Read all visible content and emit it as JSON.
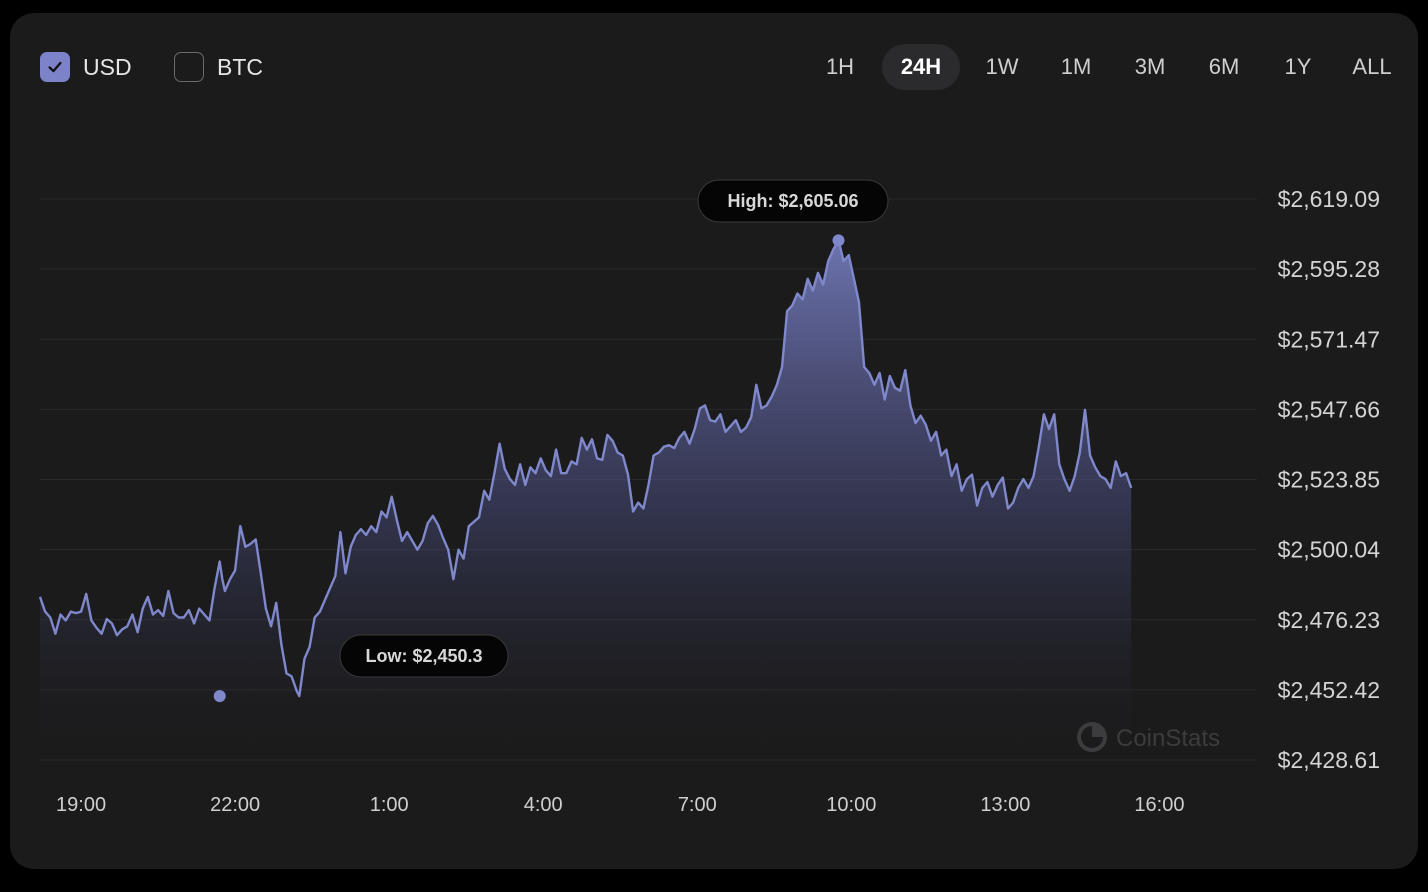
{
  "currencies": [
    {
      "label": "USD",
      "checked": true
    },
    {
      "label": "BTC",
      "checked": false
    }
  ],
  "ranges": [
    {
      "label": "1H",
      "active": false
    },
    {
      "label": "24H",
      "active": true
    },
    {
      "label": "1W",
      "active": false
    },
    {
      "label": "1M",
      "active": false
    },
    {
      "label": "3M",
      "active": false
    },
    {
      "label": "6M",
      "active": false
    },
    {
      "label": "1Y",
      "active": false
    },
    {
      "label": "ALL",
      "active": false
    }
  ],
  "watermark": "CoinStats",
  "colors": {
    "accent": "#7c83c9",
    "line": "#8088cc",
    "background": "#1b1b1c",
    "grid": "#2a2a2c"
  },
  "chart_data": {
    "type": "area",
    "x_unit": "hours since 19:00",
    "xlim": [
      -0.8,
      22.9
    ],
    "ylim": [
      2428.61,
      2619.09
    ],
    "yticks": [
      "$2,619.09",
      "$2,595.28",
      "$2,571.47",
      "$2,547.66",
      "$2,523.85",
      "$2,500.04",
      "$2,476.23",
      "$2,452.42",
      "$2,428.61"
    ],
    "xticks": [
      {
        "x": 0,
        "label": "19:00"
      },
      {
        "x": 3,
        "label": "22:00"
      },
      {
        "x": 6,
        "label": "1:00"
      },
      {
        "x": 9,
        "label": "4:00"
      },
      {
        "x": 12,
        "label": "7:00"
      },
      {
        "x": 15,
        "label": "10:00"
      },
      {
        "x": 18,
        "label": "13:00"
      },
      {
        "x": 21,
        "label": "16:00"
      }
    ],
    "grid": true,
    "high": {
      "label": "High: $2,605.06",
      "x": 14.75,
      "y": 2605.06
    },
    "low": {
      "label": "Low: $2,450.3",
      "x": 2.7,
      "y": 2450.3
    },
    "series": [
      {
        "points": [
          [
            -0.8,
            2484.0
          ],
          [
            -0.7,
            2479.0
          ],
          [
            -0.6,
            2477.0
          ],
          [
            -0.5,
            2471.5
          ],
          [
            -0.4,
            2478.0
          ],
          [
            -0.3,
            2476.0
          ],
          [
            -0.2,
            2479.0
          ],
          [
            -0.1,
            2478.5
          ],
          [
            0.0,
            2479.0
          ],
          [
            0.1,
            2485.0
          ],
          [
            0.2,
            2476.0
          ],
          [
            0.3,
            2473.5
          ],
          [
            0.4,
            2471.5
          ],
          [
            0.5,
            2476.5
          ],
          [
            0.6,
            2475.0
          ],
          [
            0.7,
            2471.0
          ],
          [
            0.8,
            2473.0
          ],
          [
            0.9,
            2474.0
          ],
          [
            1.0,
            2478.0
          ],
          [
            1.1,
            2472.0
          ],
          [
            1.2,
            2480.0
          ],
          [
            1.3,
            2484.0
          ],
          [
            1.4,
            2478.0
          ],
          [
            1.5,
            2479.5
          ],
          [
            1.6,
            2477.5
          ],
          [
            1.7,
            2486.0
          ],
          [
            1.8,
            2478.5
          ],
          [
            1.9,
            2477.0
          ],
          [
            2.0,
            2477.0
          ],
          [
            2.1,
            2479.5
          ],
          [
            2.2,
            2475.0
          ],
          [
            2.3,
            2480.0
          ],
          [
            2.4,
            2478.0
          ],
          [
            2.5,
            2476.0
          ],
          [
            2.6,
            2487.0
          ],
          [
            2.7,
            2496.0
          ],
          [
            2.75,
            2490.0
          ],
          [
            2.8,
            2486.0
          ],
          [
            2.9,
            2490.0
          ],
          [
            3.0,
            2493.0
          ],
          [
            3.1,
            2508.0
          ],
          [
            3.2,
            2501.0
          ],
          [
            3.3,
            2502.0
          ],
          [
            3.4,
            2503.5
          ],
          [
            3.5,
            2492.0
          ],
          [
            3.6,
            2480.0
          ],
          [
            3.7,
            2474.0
          ],
          [
            3.8,
            2482.0
          ],
          [
            3.9,
            2468.0
          ],
          [
            4.0,
            2458.0
          ],
          [
            4.1,
            2457.0
          ],
          [
            4.2,
            2452.0
          ],
          [
            4.25,
            2450.3
          ],
          [
            4.35,
            2463.0
          ],
          [
            4.45,
            2467.0
          ],
          [
            4.55,
            2477.0
          ],
          [
            4.65,
            2479.0
          ],
          [
            4.75,
            2483.0
          ],
          [
            4.85,
            2487.0
          ],
          [
            4.95,
            2491.0
          ],
          [
            5.05,
            2506.0
          ],
          [
            5.15,
            2492.0
          ],
          [
            5.25,
            2501.0
          ],
          [
            5.35,
            2505.0
          ],
          [
            5.45,
            2507.0
          ],
          [
            5.55,
            2505.0
          ],
          [
            5.65,
            2508.0
          ],
          [
            5.75,
            2506.0
          ],
          [
            5.85,
            2513.0
          ],
          [
            5.95,
            2511.0
          ],
          [
            6.05,
            2518.0
          ],
          [
            6.15,
            2510.0
          ],
          [
            6.25,
            2503.0
          ],
          [
            6.35,
            2506.0
          ],
          [
            6.45,
            2503.0
          ],
          [
            6.55,
            2500.0
          ],
          [
            6.65,
            2503.0
          ],
          [
            6.75,
            2509.0
          ],
          [
            6.85,
            2511.5
          ],
          [
            6.95,
            2508.5
          ],
          [
            7.05,
            2504.0
          ],
          [
            7.15,
            2500.0
          ],
          [
            7.25,
            2490.0
          ],
          [
            7.35,
            2500.0
          ],
          [
            7.45,
            2497.0
          ],
          [
            7.55,
            2508.0
          ],
          [
            7.65,
            2509.5
          ],
          [
            7.75,
            2511.0
          ],
          [
            7.85,
            2520.0
          ],
          [
            7.95,
            2517.0
          ],
          [
            8.05,
            2526.0
          ],
          [
            8.15,
            2536.0
          ],
          [
            8.25,
            2527.5
          ],
          [
            8.35,
            2524.0
          ],
          [
            8.45,
            2522.0
          ],
          [
            8.55,
            2529.0
          ],
          [
            8.65,
            2522.0
          ],
          [
            8.75,
            2528.0
          ],
          [
            8.85,
            2526.0
          ],
          [
            8.95,
            2531.0
          ],
          [
            9.05,
            2527.0
          ],
          [
            9.15,
            2525.0
          ],
          [
            9.25,
            2534.0
          ],
          [
            9.35,
            2526.0
          ],
          [
            9.45,
            2526.0
          ],
          [
            9.55,
            2530.0
          ],
          [
            9.65,
            2529.0
          ],
          [
            9.75,
            2538.0
          ],
          [
            9.85,
            2534.0
          ],
          [
            9.95,
            2537.5
          ],
          [
            10.05,
            2531.0
          ],
          [
            10.15,
            2530.5
          ],
          [
            10.25,
            2539.0
          ],
          [
            10.35,
            2537.0
          ],
          [
            10.45,
            2533.0
          ],
          [
            10.55,
            2532.0
          ],
          [
            10.65,
            2525.5
          ],
          [
            10.75,
            2513.0
          ],
          [
            10.85,
            2516.0
          ],
          [
            10.95,
            2514.0
          ],
          [
            11.05,
            2522.0
          ],
          [
            11.15,
            2532.0
          ],
          [
            11.25,
            2533.0
          ],
          [
            11.35,
            2535.0
          ],
          [
            11.45,
            2535.5
          ],
          [
            11.55,
            2534.5
          ],
          [
            11.65,
            2538.0
          ],
          [
            11.75,
            2540.0
          ],
          [
            11.85,
            2536.0
          ],
          [
            11.95,
            2541.0
          ],
          [
            12.05,
            2548.0
          ],
          [
            12.15,
            2549.0
          ],
          [
            12.25,
            2544.0
          ],
          [
            12.35,
            2543.5
          ],
          [
            12.45,
            2546.0
          ],
          [
            12.55,
            2540.0
          ],
          [
            12.65,
            2542.0
          ],
          [
            12.75,
            2544.0
          ],
          [
            12.85,
            2540.0
          ],
          [
            12.95,
            2541.5
          ],
          [
            13.05,
            2545.0
          ],
          [
            13.15,
            2556.0
          ],
          [
            13.25,
            2548.0
          ],
          [
            13.35,
            2549.0
          ],
          [
            13.45,
            2552.0
          ],
          [
            13.55,
            2556.0
          ],
          [
            13.65,
            2562.0
          ],
          [
            13.75,
            2581.0
          ],
          [
            13.85,
            2583.0
          ],
          [
            13.95,
            2587.0
          ],
          [
            14.05,
            2585.0
          ],
          [
            14.15,
            2592.0
          ],
          [
            14.25,
            2588.0
          ],
          [
            14.35,
            2594.0
          ],
          [
            14.45,
            2590.0
          ],
          [
            14.55,
            2598.0
          ],
          [
            14.65,
            2602.0
          ],
          [
            14.75,
            2605.06
          ],
          [
            14.85,
            2598.0
          ],
          [
            14.95,
            2600.0
          ],
          [
            15.05,
            2592.0
          ],
          [
            15.15,
            2584.0
          ],
          [
            15.25,
            2562.0
          ],
          [
            15.35,
            2560.0
          ],
          [
            15.45,
            2556.0
          ],
          [
            15.55,
            2560.0
          ],
          [
            15.65,
            2551.0
          ],
          [
            15.75,
            2559.0
          ],
          [
            15.85,
            2555.0
          ],
          [
            15.95,
            2554.0
          ],
          [
            16.05,
            2561.0
          ],
          [
            16.15,
            2549.0
          ],
          [
            16.25,
            2543.0
          ],
          [
            16.35,
            2545.5
          ],
          [
            16.45,
            2542.5
          ],
          [
            16.55,
            2537.0
          ],
          [
            16.65,
            2540.0
          ],
          [
            16.75,
            2532.0
          ],
          [
            16.85,
            2534.0
          ],
          [
            16.95,
            2525.0
          ],
          [
            17.05,
            2529.0
          ],
          [
            17.15,
            2520.0
          ],
          [
            17.25,
            2524.0
          ],
          [
            17.35,
            2525.5
          ],
          [
            17.45,
            2515.0
          ],
          [
            17.55,
            2521.0
          ],
          [
            17.65,
            2523.0
          ],
          [
            17.75,
            2518.0
          ],
          [
            17.85,
            2522.0
          ],
          [
            17.95,
            2524.5
          ],
          [
            18.05,
            2514.0
          ],
          [
            18.15,
            2516.0
          ],
          [
            18.25,
            2521.0
          ],
          [
            18.35,
            2524.0
          ],
          [
            18.45,
            2521.0
          ],
          [
            18.55,
            2525.0
          ],
          [
            18.65,
            2535.0
          ],
          [
            18.75,
            2546.0
          ],
          [
            18.85,
            2541.0
          ],
          [
            18.95,
            2546.0
          ],
          [
            19.05,
            2529.0
          ],
          [
            19.15,
            2524.0
          ],
          [
            19.25,
            2520.0
          ],
          [
            19.35,
            2525.0
          ],
          [
            19.45,
            2533.0
          ],
          [
            19.55,
            2547.5
          ],
          [
            19.65,
            2532.0
          ],
          [
            19.75,
            2528.0
          ],
          [
            19.85,
            2525.0
          ],
          [
            19.95,
            2524.0
          ],
          [
            20.05,
            2521.0
          ],
          [
            20.15,
            2530.0
          ],
          [
            20.25,
            2525.0
          ],
          [
            20.35,
            2526.0
          ],
          [
            20.45,
            2521.0
          ]
        ]
      }
    ]
  }
}
